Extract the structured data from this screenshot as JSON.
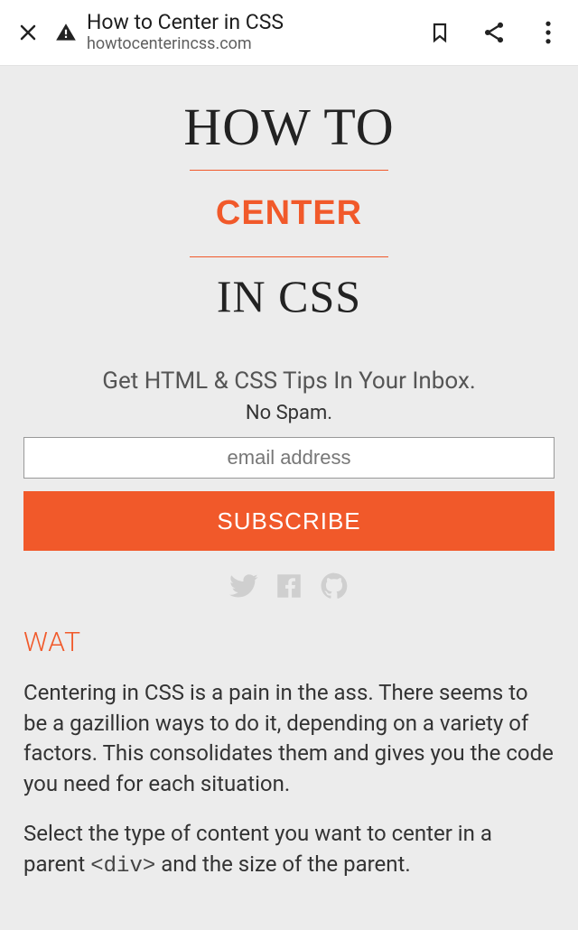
{
  "browser": {
    "title": "How to Center in CSS",
    "url": "howtocenterincss.com"
  },
  "hero": {
    "line1": "HOW TO",
    "line2": "CENTER",
    "line3": "IN CSS"
  },
  "newsletter": {
    "heading": "Get HTML & CSS Tips In Your Inbox.",
    "subheading": "No Spam.",
    "placeholder": "email address",
    "button": "SUBSCRIBE"
  },
  "section": {
    "heading": "WAT",
    "para1": "Centering in CSS is a pain in the ass. There seems to be a gazillion ways to do it, depending on a variety of factors. This consolidates them and gives you the code you need for each situation.",
    "para2_a": "Select the type of content you want to center in a parent ",
    "para2_code": "<div>",
    "para2_b": " and the size of the parent."
  },
  "icons": {
    "close": "✕",
    "warn": "⚠",
    "bookmark": "🔖",
    "share": "share",
    "menu": "⋮"
  }
}
